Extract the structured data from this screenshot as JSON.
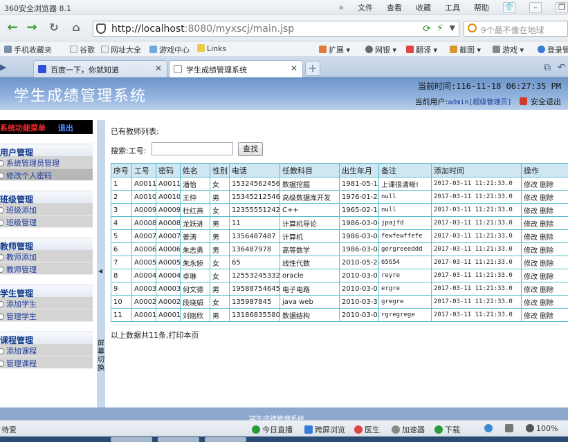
{
  "browser": {
    "title": "360安全浏览器 8.1",
    "menus": [
      "文件",
      "查看",
      "收藏",
      "工具",
      "帮助"
    ],
    "url_host": "http://localhost",
    "url_rest": ":8080/myxscj/main.jsp",
    "search_placeholder": "9个最不像在地球",
    "favorites": [
      "手机收藏夹",
      "谷歌",
      "网址大全",
      "游戏中心",
      "Links"
    ],
    "right_tools": [
      "扩展",
      "网银",
      "翻译",
      "截图",
      "游戏",
      "登录管"
    ],
    "tabs": [
      "百度一下，你就知道",
      "学生成绩管理系统"
    ]
  },
  "header": {
    "app_title": "学生成绩管理系统",
    "time_label": "当前时间:116-11-18 06:27:35 PM",
    "user_prefix": "当前用户:",
    "user_name": "admin[超级管理员]",
    "logout": "安全退出"
  },
  "sidebar": {
    "menu_title": "系统功能菜单",
    "exit": "退出",
    "groups": [
      {
        "title": "用户管理",
        "items": [
          "系统管理员管理",
          "修改个人密码"
        ]
      },
      {
        "title": "班级管理",
        "items": [
          "班级添加",
          "班级管理"
        ]
      },
      {
        "title": "教师管理",
        "items": [
          "教师添加",
          "教师管理"
        ]
      },
      {
        "title": "学生管理",
        "items": [
          "添加学生",
          "管理学生"
        ]
      },
      {
        "title": "课程管理",
        "items": [
          "添加课程",
          "管理课程"
        ]
      }
    ],
    "toggle_text": "屏幕切换"
  },
  "main": {
    "list_title": "已有教师列表:",
    "search_label": "搜索:工号:",
    "search_value": "",
    "search_button": "查找",
    "columns": [
      "序号",
      "工号",
      "密码",
      "姓名",
      "性别",
      "电话",
      "任教科目",
      "出生年月",
      "备注",
      "添加时间",
      "操作"
    ],
    "rows": [
      [
        "1",
        "A0011",
        "A0011",
        "潘怡",
        "女",
        "15324562456",
        "数据挖掘",
        "1981-05-12",
        "上课很清晰!",
        "2017-03-11 11:21:33.0"
      ],
      [
        "2",
        "A0010",
        "A0010",
        "王仲",
        "男",
        "15345212546",
        "高级数据库开发",
        "1976-01-22",
        "null",
        "2017-03-11 11:21:33.0"
      ],
      [
        "3",
        "A0009",
        "A0009",
        "杜红燕",
        "女",
        "12355551242",
        "C++",
        "1965-02-15",
        "null",
        "2017-03-11 11:21:33.0"
      ],
      [
        "4",
        "A0008",
        "A0008",
        "龙跃进",
        "男",
        "11",
        "计算机导论",
        "1986-03-04",
        "jpajfd",
        "2017-03-11 11:21:33.0"
      ],
      [
        "5",
        "A0007",
        "A0007",
        "姜涛",
        "男",
        "1356487487",
        "计算机",
        "1986-03-04",
        "fewfewffefe",
        "2017-03-11 11:21:33.0"
      ],
      [
        "6",
        "A0006",
        "A0006",
        "朱志勇",
        "男",
        "136487978",
        "高等数学",
        "1986-03-04",
        "gergreeeddd",
        "2017-03-11 11:21:33.0"
      ],
      [
        "7",
        "A0005",
        "A0005",
        "朱永娇",
        "女",
        "65",
        "线性代数",
        "2010-05-24",
        "65654",
        "2017-03-11 11:21:33.0"
      ],
      [
        "8",
        "A0004",
        "A0004",
        "卓琳",
        "女",
        "12553245332",
        "oracle",
        "2010-03-01",
        "reyre",
        "2017-03-11 11:21:33.0"
      ],
      [
        "9",
        "A0003",
        "A0003",
        "何文德",
        "男",
        "19588754645",
        "电子电路",
        "2010-03-01",
        "ergre",
        "2017-03-11 11:21:33.0"
      ],
      [
        "10",
        "A0002",
        "A0002",
        "段晓娟",
        "女",
        "135987845",
        "java web",
        "2010-03-31",
        "gregre",
        "2017-03-11 11:21:33.0"
      ],
      [
        "11",
        "A0001",
        "A0001",
        "刘刚欣",
        "男",
        "13186835580",
        "数据结构",
        "2010-03-02",
        "rgregrege",
        "2017-03-11 11:21:33.0"
      ]
    ],
    "action_edit": "修改",
    "action_delete": "删除",
    "summary": "以上数据共11条,打印本页"
  },
  "footer": {
    "text": "学生成绩管理系统"
  },
  "statusbar": {
    "left": "待爱",
    "items": [
      "今日直播",
      "跨屏浏览",
      "医生",
      "加速器",
      "下载"
    ],
    "zoom": "100%"
  },
  "colors": {
    "header_blue": "#6d94c8",
    "grid_border": "#55c0cf",
    "menu_red": "#ff2a2a"
  }
}
